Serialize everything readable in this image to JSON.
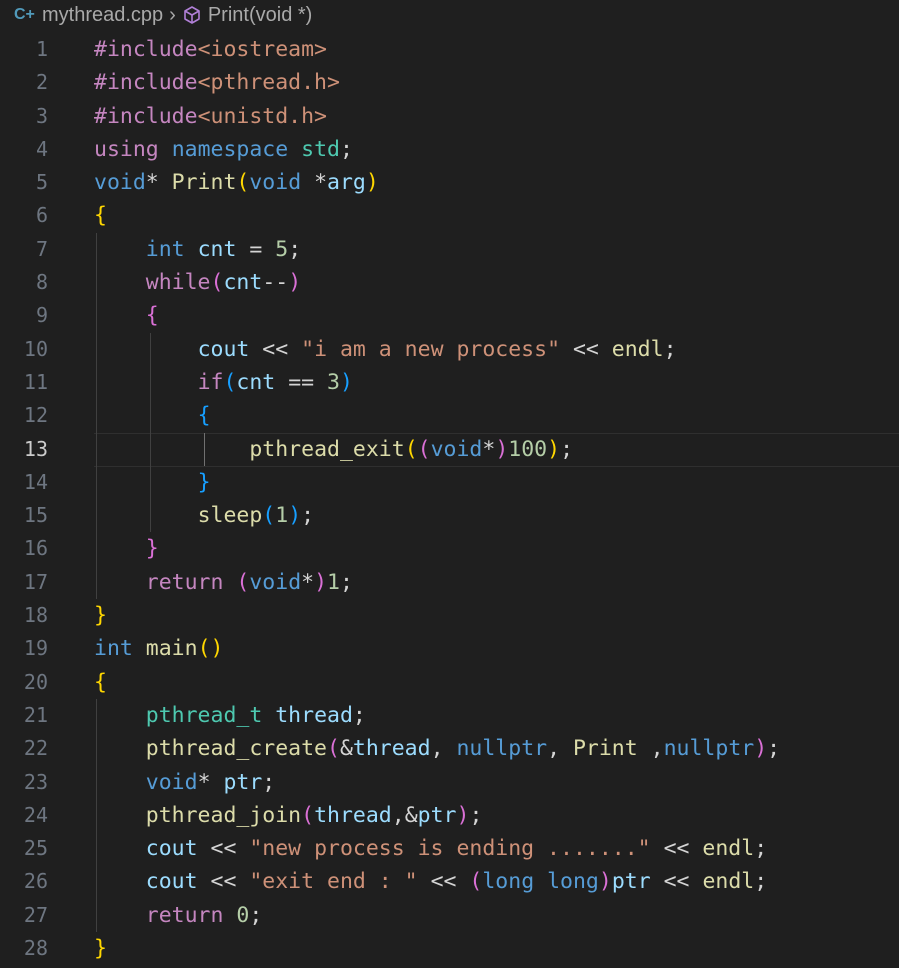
{
  "breadcrumb": {
    "file": "mythread.cpp",
    "symbol": "Print(void *)"
  },
  "editor": {
    "active_line": 13,
    "lines": [
      {
        "n": "1",
        "tokens": [
          {
            "t": "#include",
            "c": "k"
          },
          {
            "t": "<iostream>",
            "c": "s"
          }
        ]
      },
      {
        "n": "2",
        "tokens": [
          {
            "t": "#include",
            "c": "k"
          },
          {
            "t": "<pthread.h>",
            "c": "s"
          }
        ]
      },
      {
        "n": "3",
        "tokens": [
          {
            "t": "#include",
            "c": "k"
          },
          {
            "t": "<unistd.h>",
            "c": "s"
          }
        ]
      },
      {
        "n": "4",
        "tokens": [
          {
            "t": "using",
            "c": "k"
          },
          {
            "t": " ",
            "c": "p"
          },
          {
            "t": "namespace",
            "c": "b"
          },
          {
            "t": " ",
            "c": "p"
          },
          {
            "t": "std",
            "c": "t"
          },
          {
            "t": ";",
            "c": "p"
          }
        ]
      },
      {
        "n": "5",
        "tokens": [
          {
            "t": "void",
            "c": "b"
          },
          {
            "t": "* ",
            "c": "p"
          },
          {
            "t": "Print",
            "c": "f"
          },
          {
            "t": "(",
            "c": "y"
          },
          {
            "t": "void",
            "c": "b"
          },
          {
            "t": " *",
            "c": "p"
          },
          {
            "t": "arg",
            "c": "v"
          },
          {
            "t": ")",
            "c": "y"
          }
        ]
      },
      {
        "n": "6",
        "tokens": [
          {
            "t": "{",
            "c": "y"
          }
        ]
      },
      {
        "n": "7",
        "tokens": [
          {
            "t": "    ",
            "c": "p"
          },
          {
            "t": "int",
            "c": "b"
          },
          {
            "t": " ",
            "c": "p"
          },
          {
            "t": "cnt",
            "c": "v"
          },
          {
            "t": " = ",
            "c": "p"
          },
          {
            "t": "5",
            "c": "n"
          },
          {
            "t": ";",
            "c": "p"
          }
        ]
      },
      {
        "n": "8",
        "tokens": [
          {
            "t": "    ",
            "c": "p"
          },
          {
            "t": "while",
            "c": "k"
          },
          {
            "t": "(",
            "c": "m"
          },
          {
            "t": "cnt",
            "c": "v"
          },
          {
            "t": "--",
            "c": "p"
          },
          {
            "t": ")",
            "c": "m"
          }
        ]
      },
      {
        "n": "9",
        "tokens": [
          {
            "t": "    ",
            "c": "p"
          },
          {
            "t": "{",
            "c": "m"
          }
        ]
      },
      {
        "n": "10",
        "tokens": [
          {
            "t": "        ",
            "c": "p"
          },
          {
            "t": "cout",
            "c": "v"
          },
          {
            "t": " << ",
            "c": "p"
          },
          {
            "t": "\"i am a new process\"",
            "c": "s"
          },
          {
            "t": " << ",
            "c": "p"
          },
          {
            "t": "endl",
            "c": "f"
          },
          {
            "t": ";",
            "c": "p"
          }
        ]
      },
      {
        "n": "11",
        "tokens": [
          {
            "t": "        ",
            "c": "p"
          },
          {
            "t": "if",
            "c": "k"
          },
          {
            "t": "(",
            "c": "c"
          },
          {
            "t": "cnt",
            "c": "v"
          },
          {
            "t": " == ",
            "c": "p"
          },
          {
            "t": "3",
            "c": "n"
          },
          {
            "t": ")",
            "c": "c"
          }
        ]
      },
      {
        "n": "12",
        "tokens": [
          {
            "t": "        ",
            "c": "p"
          },
          {
            "t": "{",
            "c": "c"
          }
        ]
      },
      {
        "n": "13",
        "tokens": [
          {
            "t": "            ",
            "c": "p"
          },
          {
            "t": "pthread_exit",
            "c": "f"
          },
          {
            "t": "(",
            "c": "y"
          },
          {
            "t": "(",
            "c": "m"
          },
          {
            "t": "void",
            "c": "b"
          },
          {
            "t": "*",
            "c": "p"
          },
          {
            "t": ")",
            "c": "m"
          },
          {
            "t": "100",
            "c": "n"
          },
          {
            "t": ")",
            "c": "y"
          },
          {
            "t": ";",
            "c": "p"
          }
        ]
      },
      {
        "n": "14",
        "tokens": [
          {
            "t": "        ",
            "c": "p"
          },
          {
            "t": "}",
            "c": "c"
          }
        ]
      },
      {
        "n": "15",
        "tokens": [
          {
            "t": "        ",
            "c": "p"
          },
          {
            "t": "sleep",
            "c": "f"
          },
          {
            "t": "(",
            "c": "c"
          },
          {
            "t": "1",
            "c": "n"
          },
          {
            "t": ")",
            "c": "c"
          },
          {
            "t": ";",
            "c": "p"
          }
        ]
      },
      {
        "n": "16",
        "tokens": [
          {
            "t": "    ",
            "c": "p"
          },
          {
            "t": "}",
            "c": "m"
          }
        ]
      },
      {
        "n": "17",
        "tokens": [
          {
            "t": "    ",
            "c": "p"
          },
          {
            "t": "return",
            "c": "k"
          },
          {
            "t": " ",
            "c": "p"
          },
          {
            "t": "(",
            "c": "m"
          },
          {
            "t": "void",
            "c": "b"
          },
          {
            "t": "*",
            "c": "p"
          },
          {
            "t": ")",
            "c": "m"
          },
          {
            "t": "1",
            "c": "n"
          },
          {
            "t": ";",
            "c": "p"
          }
        ]
      },
      {
        "n": "18",
        "tokens": [
          {
            "t": "}",
            "c": "y"
          }
        ]
      },
      {
        "n": "19",
        "tokens": [
          {
            "t": "int",
            "c": "b"
          },
          {
            "t": " ",
            "c": "p"
          },
          {
            "t": "main",
            "c": "f"
          },
          {
            "t": "()",
            "c": "y"
          }
        ]
      },
      {
        "n": "20",
        "tokens": [
          {
            "t": "{",
            "c": "y"
          }
        ]
      },
      {
        "n": "21",
        "tokens": [
          {
            "t": "    ",
            "c": "p"
          },
          {
            "t": "pthread_t",
            "c": "t"
          },
          {
            "t": " ",
            "c": "p"
          },
          {
            "t": "thread",
            "c": "v"
          },
          {
            "t": ";",
            "c": "p"
          }
        ]
      },
      {
        "n": "22",
        "tokens": [
          {
            "t": "    ",
            "c": "p"
          },
          {
            "t": "pthread_create",
            "c": "f"
          },
          {
            "t": "(",
            "c": "m"
          },
          {
            "t": "&",
            "c": "p"
          },
          {
            "t": "thread",
            "c": "v"
          },
          {
            "t": ", ",
            "c": "p"
          },
          {
            "t": "nullptr",
            "c": "b"
          },
          {
            "t": ", ",
            "c": "p"
          },
          {
            "t": "Print",
            "c": "f"
          },
          {
            "t": " ,",
            "c": "p"
          },
          {
            "t": "nullptr",
            "c": "b"
          },
          {
            "t": ")",
            "c": "m"
          },
          {
            "t": ";",
            "c": "p"
          }
        ]
      },
      {
        "n": "23",
        "tokens": [
          {
            "t": "    ",
            "c": "p"
          },
          {
            "t": "void",
            "c": "b"
          },
          {
            "t": "* ",
            "c": "p"
          },
          {
            "t": "ptr",
            "c": "v"
          },
          {
            "t": ";",
            "c": "p"
          }
        ]
      },
      {
        "n": "24",
        "tokens": [
          {
            "t": "    ",
            "c": "p"
          },
          {
            "t": "pthread_join",
            "c": "f"
          },
          {
            "t": "(",
            "c": "m"
          },
          {
            "t": "thread",
            "c": "v"
          },
          {
            "t": ",&",
            "c": "p"
          },
          {
            "t": "ptr",
            "c": "v"
          },
          {
            "t": ")",
            "c": "m"
          },
          {
            "t": ";",
            "c": "p"
          }
        ]
      },
      {
        "n": "25",
        "tokens": [
          {
            "t": "    ",
            "c": "p"
          },
          {
            "t": "cout",
            "c": "v"
          },
          {
            "t": " << ",
            "c": "p"
          },
          {
            "t": "\"new process is ending .......\"",
            "c": "s"
          },
          {
            "t": " << ",
            "c": "p"
          },
          {
            "t": "endl",
            "c": "f"
          },
          {
            "t": ";",
            "c": "p"
          }
        ]
      },
      {
        "n": "26",
        "tokens": [
          {
            "t": "    ",
            "c": "p"
          },
          {
            "t": "cout",
            "c": "v"
          },
          {
            "t": " << ",
            "c": "p"
          },
          {
            "t": "\"exit end : \"",
            "c": "s"
          },
          {
            "t": " << ",
            "c": "p"
          },
          {
            "t": "(",
            "c": "m"
          },
          {
            "t": "long long",
            "c": "b"
          },
          {
            "t": ")",
            "c": "m"
          },
          {
            "t": "ptr",
            "c": "v"
          },
          {
            "t": " << ",
            "c": "p"
          },
          {
            "t": "endl",
            "c": "f"
          },
          {
            "t": ";",
            "c": "p"
          }
        ]
      },
      {
        "n": "27",
        "tokens": [
          {
            "t": "    ",
            "c": "p"
          },
          {
            "t": "return",
            "c": "k"
          },
          {
            "t": " ",
            "c": "p"
          },
          {
            "t": "0",
            "c": "n"
          },
          {
            "t": ";",
            "c": "p"
          }
        ]
      },
      {
        "n": "28",
        "tokens": [
          {
            "t": "}",
            "c": "y"
          }
        ]
      }
    ]
  }
}
